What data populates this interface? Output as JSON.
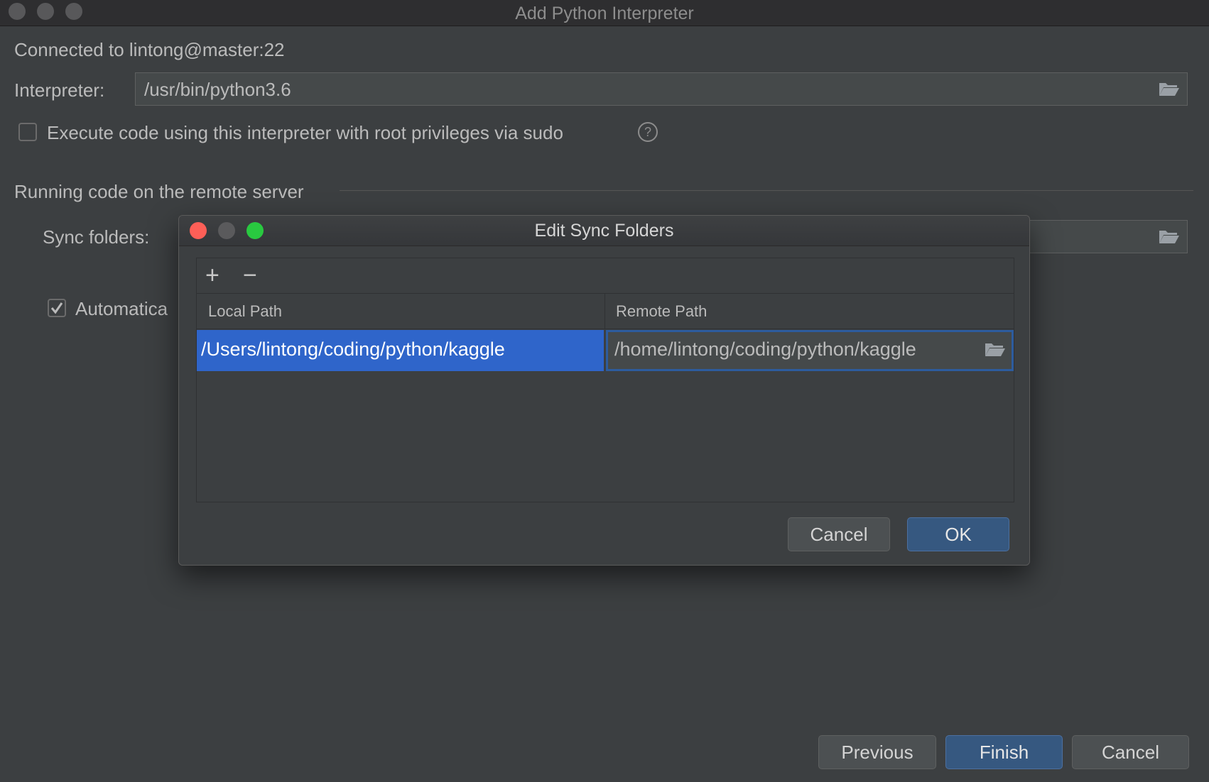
{
  "window": {
    "title": "Add Python Interpreter"
  },
  "connection": {
    "text": "Connected to lintong@master:22"
  },
  "interpreter": {
    "label": "Interpreter:",
    "value": "/usr/bin/python3.6"
  },
  "sudo": {
    "label": "Execute code using this interpreter with root privileges via sudo",
    "checked": false
  },
  "remote_section": {
    "title": "Running code on the remote server"
  },
  "sync": {
    "label": "Sync folders:"
  },
  "auto_upload": {
    "label": "Automatica",
    "checked": true
  },
  "footer": {
    "previous": "Previous",
    "finish": "Finish",
    "cancel": "Cancel"
  },
  "dialog": {
    "title": "Edit Sync Folders",
    "add_symbol": "+",
    "remove_symbol": "−",
    "columns": [
      "Local Path",
      "Remote Path"
    ],
    "rows": [
      {
        "local": "/Users/lintong/coding/python/kaggle",
        "remote": "/home/lintong/coding/python/kaggle"
      }
    ],
    "cancel": "Cancel",
    "ok": "OK"
  },
  "colors": {
    "background": "#3c3f41",
    "selection": "#2f65ca",
    "primary_button": "#365880",
    "close": "#fe5f57",
    "minimize": "#5a5a5c",
    "maximize": "#29c940"
  }
}
